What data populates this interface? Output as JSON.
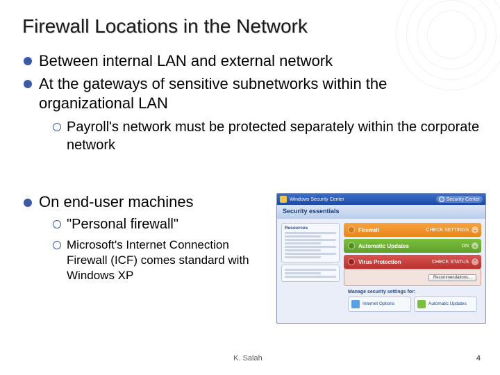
{
  "title": "Firewall Locations in the Network",
  "bullets": {
    "b1": "Between internal LAN and external network",
    "b2": "At the gateways of sensitive subnetworks within the organizational LAN",
    "b2_sub": "Payroll's network must be protected separately within the corporate network",
    "b3": "On end-user machines",
    "b3_sub1": "\"Personal firewall\"",
    "b3_sub2": "Microsoft's Internet Connection Firewall (ICF) comes standard with Windows XP"
  },
  "screenshot": {
    "window_title": "Windows Security Center",
    "badge": "Security Center",
    "banner": "Security essentials",
    "side": {
      "resources": "Resources"
    },
    "items": {
      "firewall": {
        "label": "Firewall",
        "status": "CHECK SETTINGS"
      },
      "updates": {
        "label": "Automatic Updates",
        "status": "ON"
      },
      "virus": {
        "label": "Virus Protection",
        "status": "CHECK STATUS"
      }
    },
    "recommend_btn": "Recommendations...",
    "footer_heading": "Manage security settings for:",
    "cards": {
      "a": "Internet Options",
      "b": "Automatic Updates"
    }
  },
  "footer": {
    "author": "K. Salah",
    "page": "4"
  }
}
